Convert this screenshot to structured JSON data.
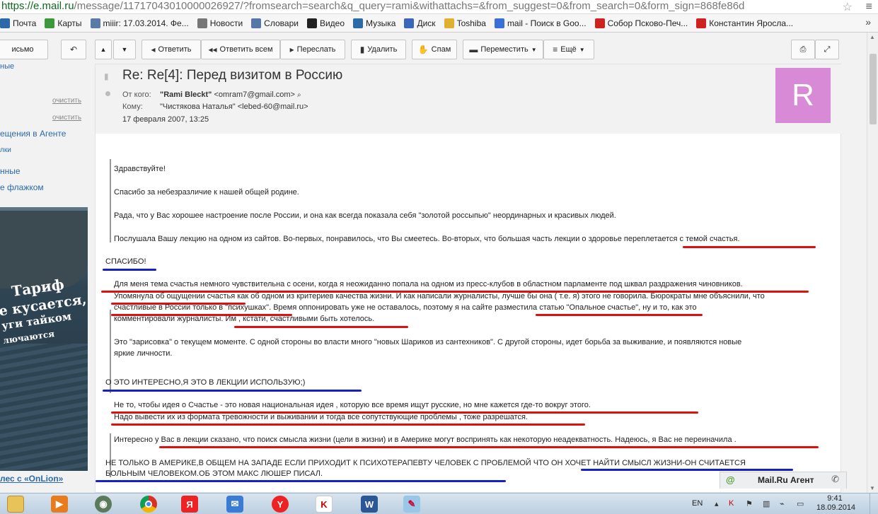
{
  "browser": {
    "url_host": "https://e.mail.ru",
    "url_rest": "/message/11717043010000026927/?fromsearch=search&q_query=rami&withattachs=&from_suggest=0&from_search=0&form_sign=868fe86d",
    "bookmarks": [
      {
        "label": "Почта",
        "color": "#2a6aa8"
      },
      {
        "label": "Карты",
        "color": "#3a9a3a"
      },
      {
        "label": "miiir: 17.03.2014. Фе...",
        "color": "#5a7aa8"
      },
      {
        "label": "Новости",
        "color": "#777777"
      },
      {
        "label": "Словари",
        "color": "#5577aa"
      },
      {
        "label": "Видео",
        "color": "#222222"
      },
      {
        "label": "Музыка",
        "color": "#2a6aa8"
      },
      {
        "label": "Диск",
        "color": "#3a66bb"
      },
      {
        "label": "Toshiba",
        "color": "#e0b030"
      },
      {
        "label": "mail - Поиск в Goo...",
        "color": "#3a6fd8"
      },
      {
        "label": "Собор Псково-Печ...",
        "color": "#d02020"
      },
      {
        "label": "Константин Яросла...",
        "color": "#d02020"
      }
    ]
  },
  "toolbar": {
    "back_label": "исьмо",
    "reply": "Ответить",
    "reply_all": "Ответить всем",
    "forward": "Переслать",
    "delete": "Удалить",
    "spam": "Спам",
    "move": "Переместить",
    "more": "Ещё"
  },
  "sidebar": {
    "link1": "ные",
    "clear1": "очистить",
    "clear2": "очистить",
    "link2": "ещения в Агенте",
    "link3": "лки",
    "link4": "нные",
    "link5": "е флажком",
    "ad_text1": "Тариф",
    "ad_text2": "е кусается,",
    "ad_text3": "уги тайком",
    "ad_text4": "лючаются",
    "promo": "лес с «OnLion»"
  },
  "message": {
    "subject": "Re: Re[4]: Перед визитом в Россию",
    "from_label": "От кого:",
    "from_name": "\"Rami Bleckt\"",
    "from_email": "<omram7@gmail.com>",
    "to_label": "Кому:",
    "to_value": "\"Чистякова Наталья\" <lebed-60@mail.ru>",
    "date": "17 февраля 2007, 13:25",
    "avatar_letter": "R",
    "lines": {
      "l1": "Здравствуйте!",
      "l2": "Спасибо за небезразличие к нашей  общей родине.",
      "l3": "Рада, что у Вас  хорошее настроение  после России, и она  как всегда   показала себя  \"золотой россыпью\" неординарных и  красивых людей.",
      "l4": "Послушала   Вашу  лекцию на  одном из сайтов.  Во-первых, понравилось, что Вы смеетесь. Во-вторых,  что   большая  часть лекции о здоровье   переплетается с темой  счастья.",
      "r1": "СПАСИБО!",
      "l5": "Для меня  тема счастья    немного чувствительна с осени, когда  я неожиданно попала на одном из пресс-клубов  в областном парламенте    под  шквал  раздражения  чиновников.",
      "l6": "Упомянула  об ощущении счастья  как  об одном из критериев качества жизни.  И как написали журналисты, лучше бы она  ( т.е. я) этого не говорила.   Бюрократы  мне объяснили, что",
      "l7": "счастливые в России  только в \"психушках\".   Время  оппонировать уже не оставалось, поэтому  я на сайте  разместила статью  \"Опальное  счастье\",  ну  и то, как  это",
      "l8": "комментировали  журналисты.  Им , кстати,  счастливыми   быть хотелось.",
      "l9": "Это \"зарисовка\"  о текущем моменте. С одной стороны  во власти много \"новых   Шариков из  сантехников\". С другой  стороны,  идет  борьба за выживание,  и появляются   новые",
      "l10": "яркие личности.",
      "r2": "О ЭТО ИНТЕРЕСНО,Я ЭТО В ЛЕКЦИИ ИСПОЛЬЗУЮ;)",
      "l11": "Не то, чтобы  идея  о Счастье  - это   новая  национальная   идея , которую  все время  ищут русские, но мне кажется  где-то вокруг этого.",
      "l12": "Надо вывести их  из формата  тревожности и выживании и тогда все сопутствующие проблемы , тоже разрешатся.",
      "l13": "Интересно  у Вас в лекции сказано, что     поиск  смысла   жизни (цели в жизни) и в Америке могут  воспринять как некоторую неадекватность.  Надеюсь,   я   Вас не переиначила .",
      "r3a": "НЕ ТОЛЬКО В АМЕРИКЕ,В ОБЩЕМ НА ЗАПАДЕ ЕСЛИ ПРИХОДИТ К ПСИХОТЕРАПЕВТУ ЧЕЛОВЕК С ПРОБЛЕМОЙ ЧТО ОН ХОЧЕТ НАЙТИ СМЫСЛ ЖИЗНИ-ОН СЧИТАЕТСЯ",
      "r3b": "БОЛЬНЫМ ЧЕЛОВЕКОМ.ОБ ЭТОМ МАКС ЛЮШЕР ПИСАЛ."
    }
  },
  "agent": {
    "name": "Mail.Ru Агент"
  },
  "taskbar": {
    "lang": "EN",
    "time": "9:41",
    "date": "18.09.2014"
  },
  "colors": {
    "underline_red": "#e01010",
    "underline_blue": "#1620c8",
    "avatar_bg": "#d98ad6",
    "link": "#2a6aa8"
  }
}
